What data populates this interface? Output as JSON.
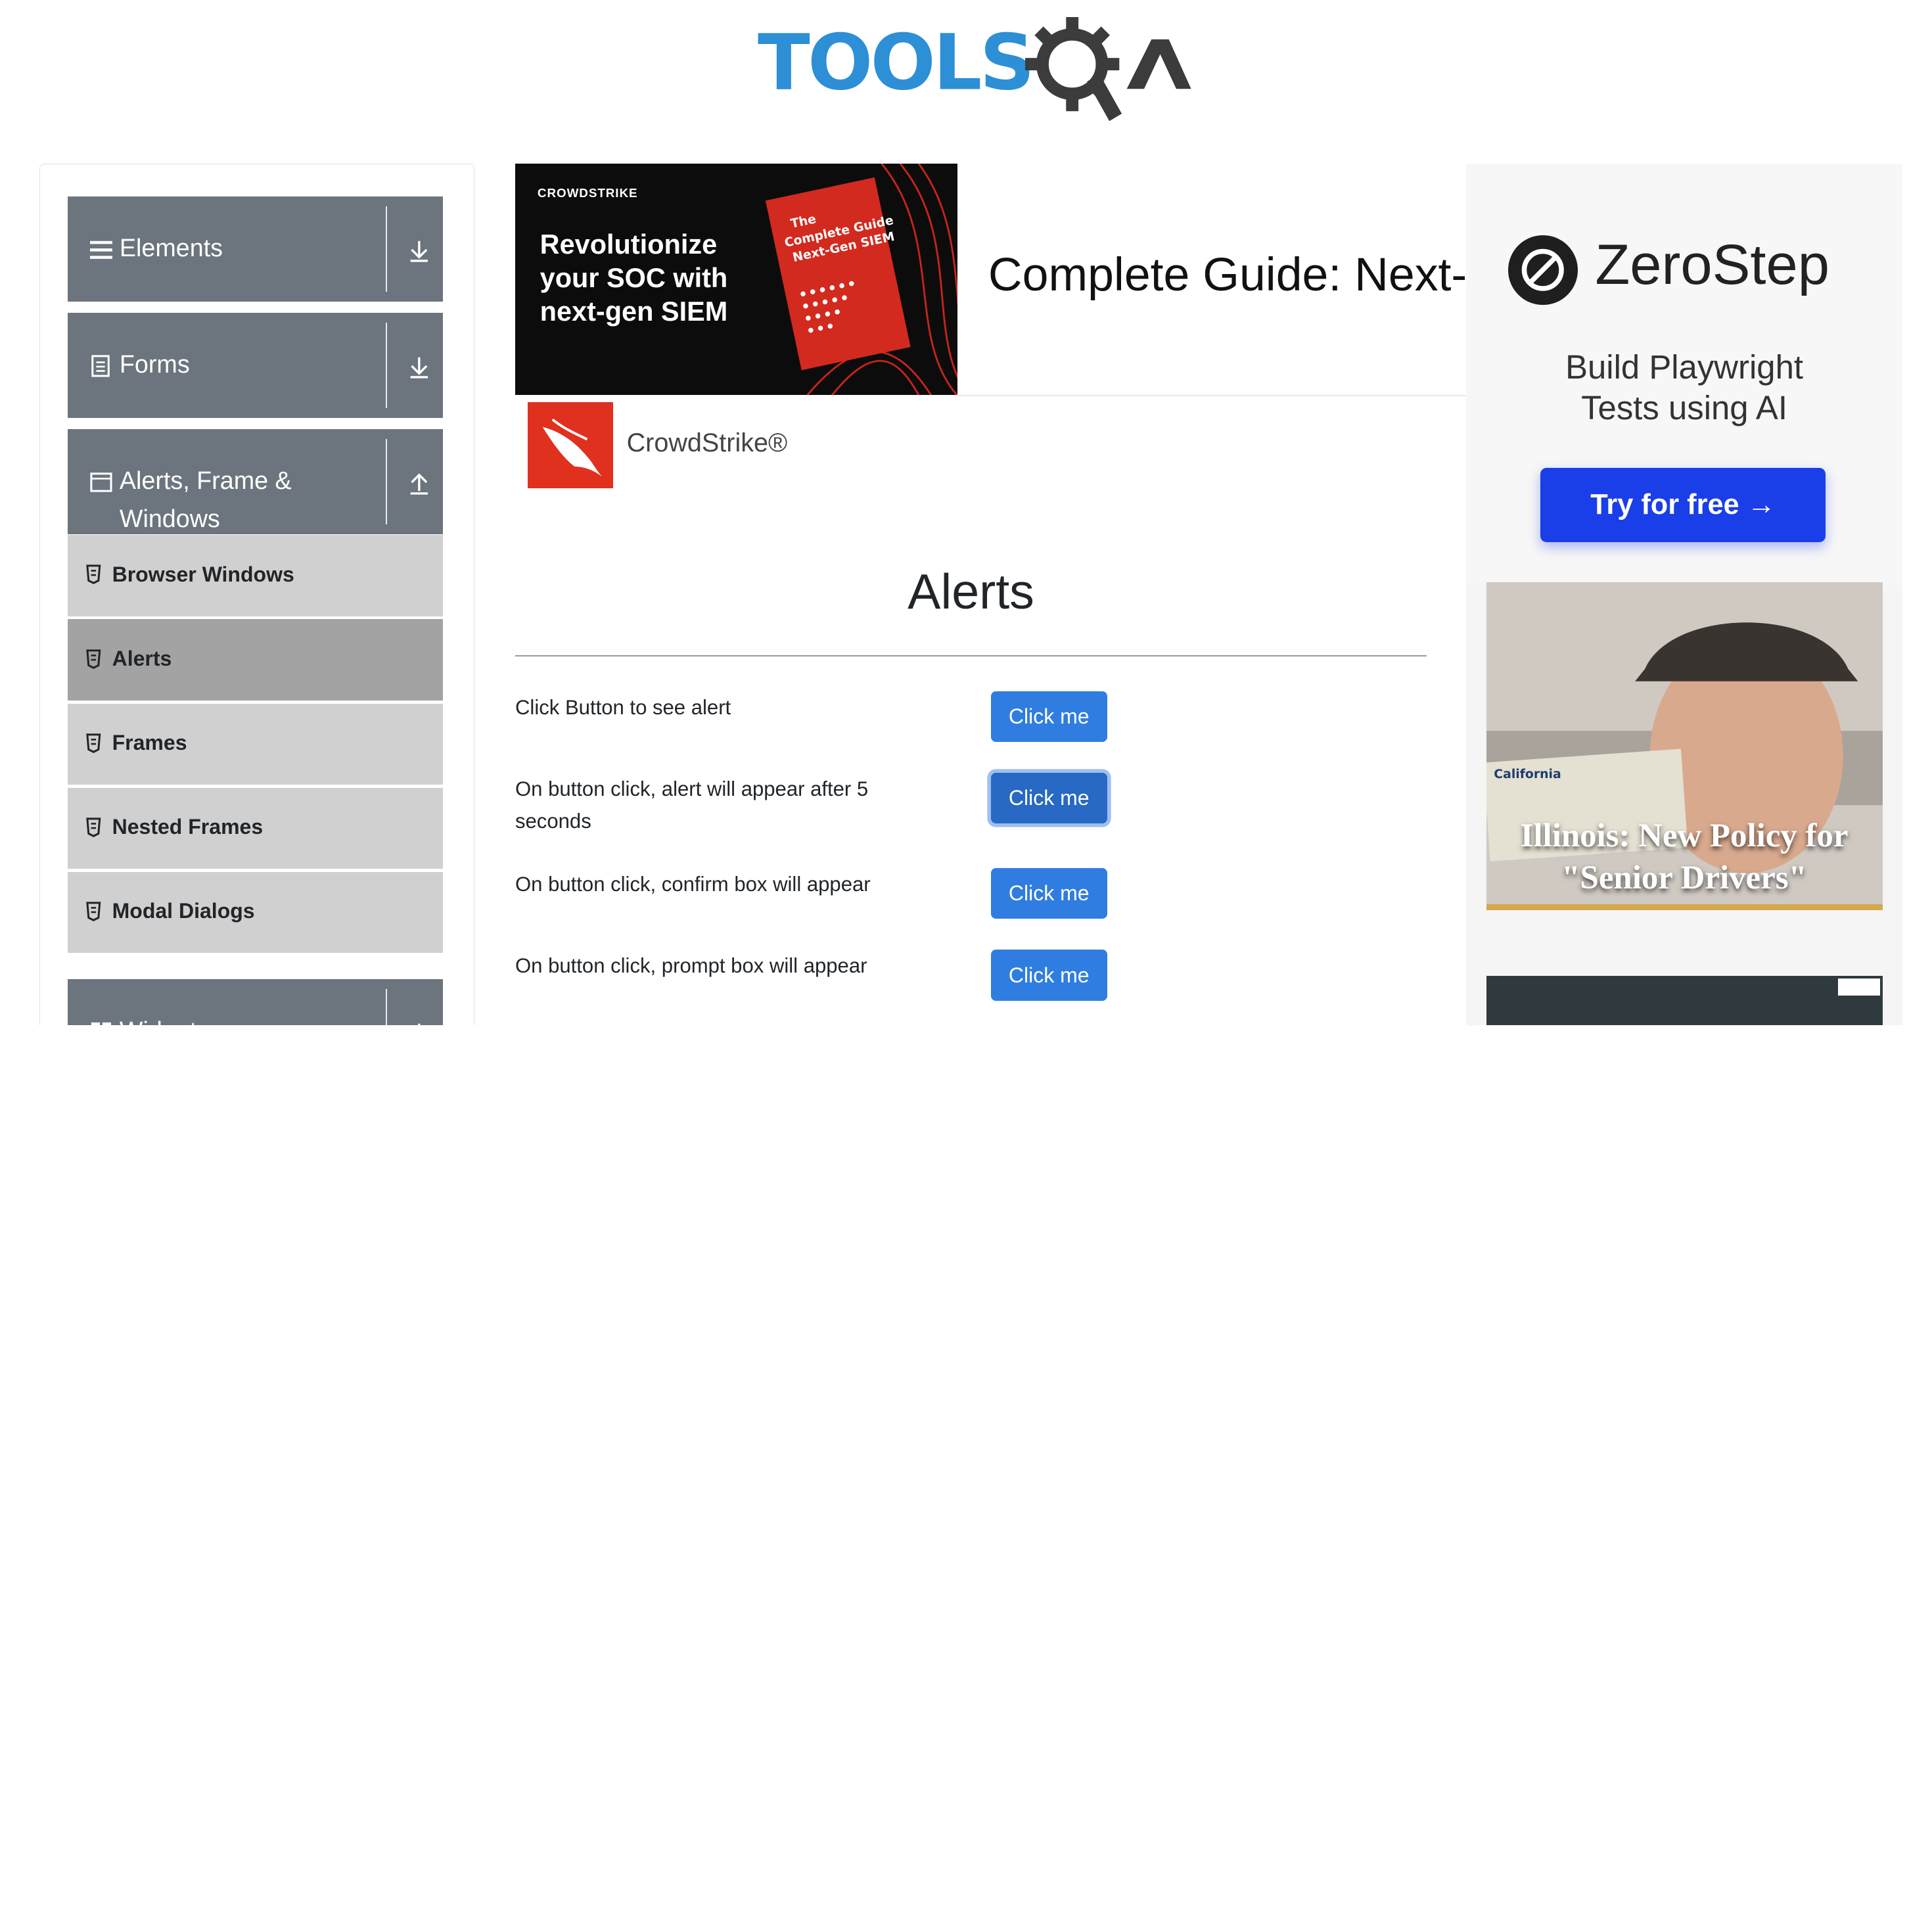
{
  "logo": {
    "text": "TOOLSQA"
  },
  "sidebar": {
    "groups": [
      {
        "label": "Elements",
        "icon": "hamburger-icon",
        "arrow": "download-icon"
      },
      {
        "label": "Forms",
        "icon": "document-icon",
        "arrow": "download-icon"
      },
      {
        "label_line1": "Alerts, Frame &",
        "label_line2": "Windows",
        "icon": "window-icon",
        "arrow": "upload-icon"
      },
      {
        "label": "Widgets",
        "icon": "grid-icon",
        "arrow": "download-icon"
      }
    ],
    "items": [
      {
        "label": "Browser Windows"
      },
      {
        "label": "Alerts"
      },
      {
        "label": "Frames"
      },
      {
        "label": "Nested Frames"
      },
      {
        "label": "Modal Dialogs"
      }
    ]
  },
  "ad_top": {
    "brand": "CROWDSTRIKE",
    "headline": "Revolutionize your SOC with next-gen SIEM",
    "book_title": "The Complete Guide to Next-Gen SIEM",
    "title": "Complete Guide: Next-",
    "advertiser": "CrowdStrike®"
  },
  "main": {
    "title": "Alerts",
    "rows": [
      {
        "label": "Click Button to see alert",
        "button": "Click me"
      },
      {
        "label": "On button click, alert will appear after 5 seconds",
        "button": "Click me"
      },
      {
        "label": "On button click, confirm box will appear",
        "button": "Click me"
      },
      {
        "label": "On button click, prompt box will appear",
        "button": "Click me"
      }
    ]
  },
  "ad_right": {
    "brand": "ZeroStep",
    "tagline_line1": "Build Playwright",
    "tagline_line2": "Tests using AI",
    "cta": "Try for free →",
    "photo_caption_line1": "Illinois: New Policy for",
    "photo_caption_line2": "\"Senior Drivers\""
  },
  "colors": {
    "accent": "#2f7de1",
    "sidebar_header": "#6c757d",
    "sidebar_item": "#d0d0d0",
    "sidebar_item_active": "#a3a3a3",
    "logo_blue": "#2d8fd5",
    "logo_dark": "#3c3c3c"
  }
}
